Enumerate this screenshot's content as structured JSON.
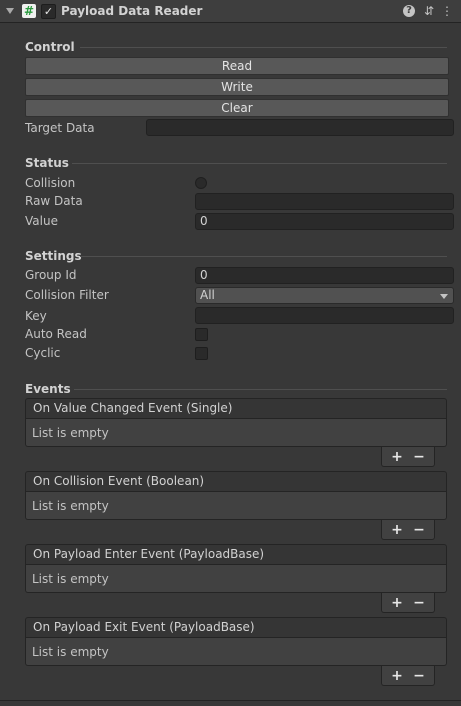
{
  "component": {
    "title": "Payload Data Reader",
    "enabled_mark": "✓",
    "script_icon_glyph": "#"
  },
  "header_icons": {
    "help": "?",
    "presets": "⇵",
    "more": "⋮"
  },
  "control": {
    "heading": "Control",
    "read_label": "Read",
    "write_label": "Write",
    "clear_label": "Clear",
    "target_data_label": "Target Data",
    "target_data_value": ""
  },
  "status": {
    "heading": "Status",
    "collision_label": "Collision",
    "raw_data_label": "Raw Data",
    "raw_data_value": "",
    "value_label": "Value",
    "value_value": "0"
  },
  "settings": {
    "heading": "Settings",
    "group_id_label": "Group Id",
    "group_id_value": "0",
    "collision_filter_label": "Collision Filter",
    "collision_filter_value": "All",
    "key_label": "Key",
    "key_value": "",
    "auto_read_label": "Auto Read",
    "auto_read_checked": false,
    "cyclic_label": "Cyclic",
    "cyclic_checked": false
  },
  "events": {
    "heading": "Events",
    "items": [
      {
        "title": "On Value Changed Event (Single)",
        "body": "List is empty"
      },
      {
        "title": "On Collision Event (Boolean)",
        "body": "List is empty"
      },
      {
        "title": "On Payload Enter Event (PayloadBase)",
        "body": "List is empty"
      },
      {
        "title": "On Payload Exit Event (PayloadBase)",
        "body": "List is empty"
      }
    ],
    "add_label": "+",
    "remove_label": "−"
  }
}
